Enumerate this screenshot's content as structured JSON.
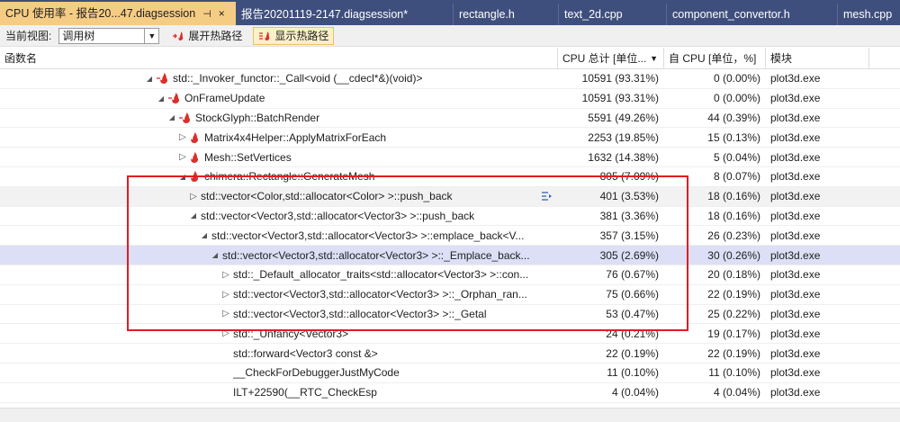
{
  "tabs": [
    {
      "label": "CPU 使用率 - 报告20...47.diagsession",
      "active": true,
      "pin": "⊣",
      "close": "×"
    },
    {
      "label": "报告20201119-2147.diagsession*"
    },
    {
      "label": "rectangle.h"
    },
    {
      "label": "text_2d.cpp"
    },
    {
      "label": "component_convertor.h"
    },
    {
      "label": "mesh.cpp"
    }
  ],
  "toolbar": {
    "view_label": "当前视图:",
    "view_value": "调用树",
    "expand_hot_path": "展开热路径",
    "show_hot_path": "显示热路径"
  },
  "columns": {
    "name": "函数名",
    "total": "CPU 总计 [单位...",
    "self": "自 CPU [单位，%]",
    "module": "模块"
  },
  "rows": [
    {
      "name": "std::_Invoker_functor::_Call<void (__cdecl*&)(void)>",
      "total": "10591 (93.31%)",
      "self": "0 (0.00%)",
      "module": "plot3d.exe"
    },
    {
      "name": "OnFrameUpdate",
      "total": "10591 (93.31%)",
      "self": "0 (0.00%)",
      "module": "plot3d.exe"
    },
    {
      "name": "StockGlyph::BatchRender",
      "total": "5591 (49.26%)",
      "self": "44 (0.39%)",
      "module": "plot3d.exe"
    },
    {
      "name": "Matrix4x4Helper::ApplyMatrixForEach",
      "total": "2253 (19.85%)",
      "self": "15 (0.13%)",
      "module": "plot3d.exe"
    },
    {
      "name": "Mesh::SetVertices",
      "total": "1632 (14.38%)",
      "self": "5 (0.04%)",
      "module": "plot3d.exe"
    },
    {
      "name": "chimera::Rectangle::GenerateMesh",
      "total": "805 (7.09%)",
      "self": "8 (0.07%)",
      "module": "plot3d.exe"
    },
    {
      "name": "std::vector<Color,std::allocator<Color> >::push_back",
      "total": "401 (3.53%)",
      "self": "18 (0.16%)",
      "module": "plot3d.exe"
    },
    {
      "name": "std::vector<Vector3,std::allocator<Vector3> >::push_back",
      "total": "381 (3.36%)",
      "self": "18 (0.16%)",
      "module": "plot3d.exe"
    },
    {
      "name": "std::vector<Vector3,std::allocator<Vector3> >::emplace_back<V...",
      "total": "357 (3.15%)",
      "self": "26 (0.23%)",
      "module": "plot3d.exe"
    },
    {
      "name": "std::vector<Vector3,std::allocator<Vector3> >::_Emplace_back...",
      "total": "305 (2.69%)",
      "self": "30 (0.26%)",
      "module": "plot3d.exe"
    },
    {
      "name": "std::_Default_allocator_traits<std::allocator<Vector3> >::con...",
      "total": "76 (0.67%)",
      "self": "20 (0.18%)",
      "module": "plot3d.exe"
    },
    {
      "name": "std::vector<Vector3,std::allocator<Vector3> >::_Orphan_ran...",
      "total": "75 (0.66%)",
      "self": "22 (0.19%)",
      "module": "plot3d.exe"
    },
    {
      "name": "std::vector<Vector3,std::allocator<Vector3> >::_Getal",
      "total": "53 (0.47%)",
      "self": "25 (0.22%)",
      "module": "plot3d.exe"
    },
    {
      "name": "std::_Unfancy<Vector3>",
      "total": "24 (0.21%)",
      "self": "19 (0.17%)",
      "module": "plot3d.exe"
    },
    {
      "name": "std::forward<Vector3 const &>",
      "total": "22 (0.19%)",
      "self": "22 (0.19%)",
      "module": "plot3d.exe"
    },
    {
      "name": "__CheckForDebuggerJustMyCode",
      "total": "11 (0.10%)",
      "self": "11 (0.10%)",
      "module": "plot3d.exe"
    },
    {
      "name": "ILT+22590(__RTC_CheckEsp",
      "total": "4 (0.04%)",
      "self": "4 (0.04%)",
      "module": "plot3d.exe"
    }
  ],
  "colors": {
    "tab_bar": "#3f4f7d",
    "active_tab": "#f5cc84",
    "hot_path": "#d9302c",
    "selection": "#dcdff5",
    "highlight_box": "#e31b23"
  }
}
